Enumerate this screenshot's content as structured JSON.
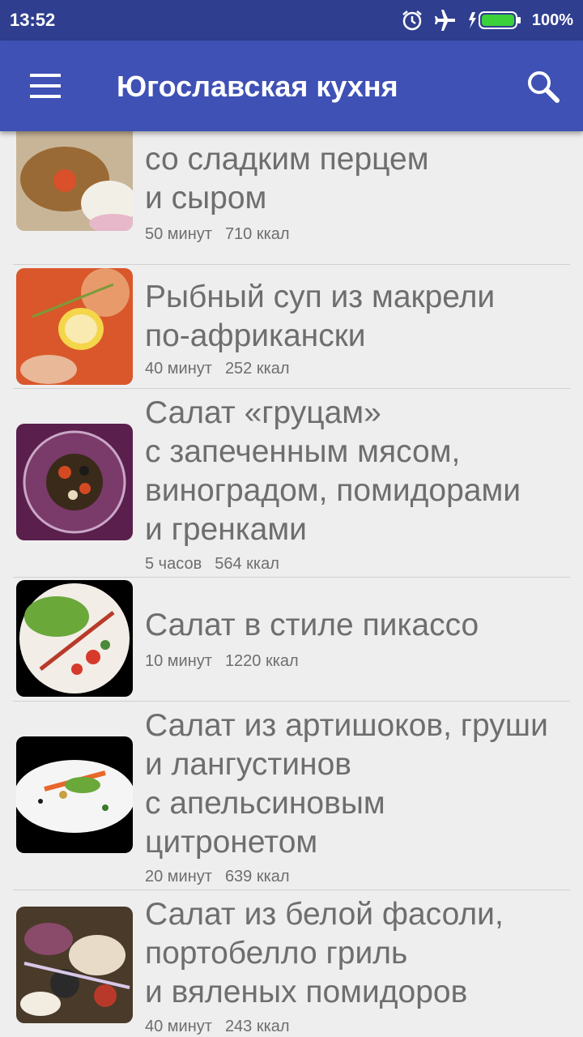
{
  "status_bar": {
    "time": "13:52",
    "battery": "100%"
  },
  "app_bar": {
    "title": "Югославская кухня"
  },
  "recipes": [
    {
      "title": "со сладким перцем\nи сыром",
      "time": "50 минут",
      "kcal": "710 ккал"
    },
    {
      "title": "Рыбный суп из макрели\nпо-африкански",
      "time": "40 минут",
      "kcal": "252 ккал"
    },
    {
      "title": "Салат «груцам»\nс запеченным мясом,\nвиноградом, помидорами\nи гренками",
      "time": "5 часов",
      "kcal": "564 ккал"
    },
    {
      "title": "Салат в стиле пикассо",
      "time": "10 минут",
      "kcal": "1220 ккал"
    },
    {
      "title": "Салат из артишоков, груши\nи лангустинов\nс апельсиновым\nцитронетом",
      "time": "20 минут",
      "kcal": "639 ккал"
    },
    {
      "title": "Салат из белой фасоли,\nпортобелло гриль\nи вяленых помидоров",
      "time": "40 минут",
      "kcal": "243 ккал"
    }
  ]
}
